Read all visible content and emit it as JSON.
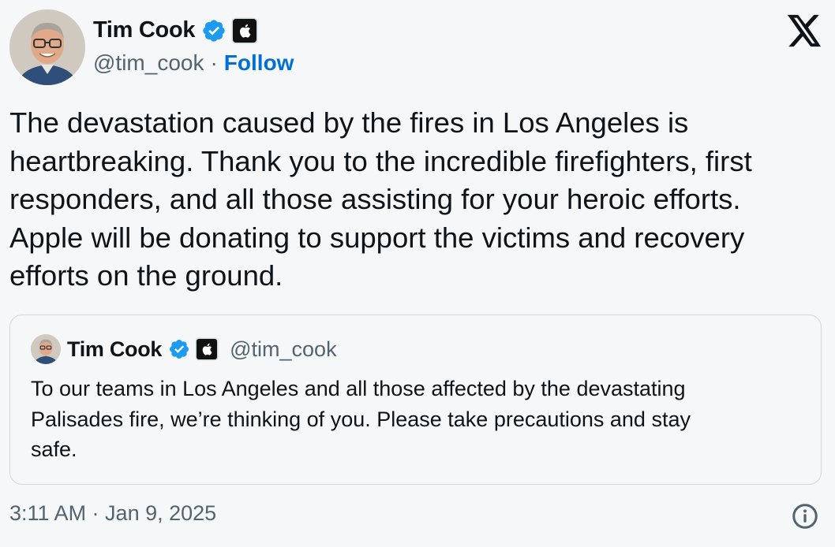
{
  "author": {
    "name": "Tim Cook",
    "handle": "@tim_cook",
    "separator": "·",
    "follow_label": "Follow",
    "verified_icon": "verified-badge-icon",
    "affiliation_icon": "apple-logo-icon"
  },
  "tweet": {
    "lines": [
      "The devastation caused by the fires in Los Angeles is",
      "heartbreaking. Thank you to the incredible firefighters, first",
      "responders, and all those assisting for your heroic efforts.",
      "Apple will be donating to support the victims and recovery",
      "efforts on the ground."
    ],
    "timestamp": "3:11 AM · Jan 9, 2025"
  },
  "quoted_tweet": {
    "name": "Tim Cook",
    "handle": "@tim_cook",
    "lines": [
      "To our teams in Los Angeles and all those affected by the devastating",
      "Palisades fire, we’re thinking of you. Please take precautions and stay",
      "safe."
    ]
  },
  "colors": {
    "background": "#f5f7f8",
    "link_blue": "#006fd6",
    "verified_blue": "#1d9bf0",
    "secondary_text": "#536471"
  },
  "icons": {
    "platform": "x-logo-icon",
    "info": "info-icon"
  }
}
